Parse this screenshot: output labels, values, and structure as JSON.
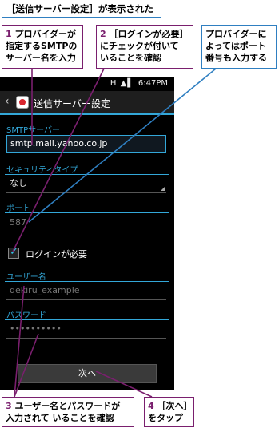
{
  "header": {
    "title": "［送信サーバー設定］が表示された"
  },
  "callouts": {
    "c1": {
      "num": "1",
      "text_line1": "プロバイダーが",
      "text_line2": "指定するSMTPの",
      "text_line3": "サーバー名を入力"
    },
    "c2": {
      "num": "2",
      "text_line1": "［ログインが必要］",
      "text_line2": "にチェックが付いて",
      "text_line3": "いることを確認"
    },
    "c_blue": {
      "text_line1": "プロバイダーに",
      "text_line2": "よってはポート",
      "text_line3": "番号も入力する"
    },
    "c3": {
      "num": "3",
      "text_line1": "ユーザー名とパスワードが",
      "text_line2": "入力されて いることを確認"
    },
    "c4": {
      "num": "4",
      "text_line1": "［次へ］",
      "text_line2": "をタップ"
    }
  },
  "phone": {
    "status": {
      "time": "6:47PM",
      "icons": "H ▲▌"
    },
    "appbar": {
      "title": "送信サーバー設定"
    },
    "smtp": {
      "label": "SMTPサーバー",
      "value": "smtp.mail.yahoo.co.jp"
    },
    "security": {
      "label": "セキュリティタイプ",
      "value": "なし"
    },
    "port": {
      "label": "ポート",
      "value": "587"
    },
    "login": {
      "label": "ログインが必要",
      "checked": true
    },
    "username": {
      "label": "ユーザー名",
      "value": "dekiru_example"
    },
    "password": {
      "label": "パスワード",
      "value": "••••••••••"
    },
    "next_button": {
      "label": "次へ"
    }
  },
  "colors": {
    "accent": "#33a7d8",
    "callout_border": "#7a1f6e",
    "header_border": "#2f7fc1"
  }
}
